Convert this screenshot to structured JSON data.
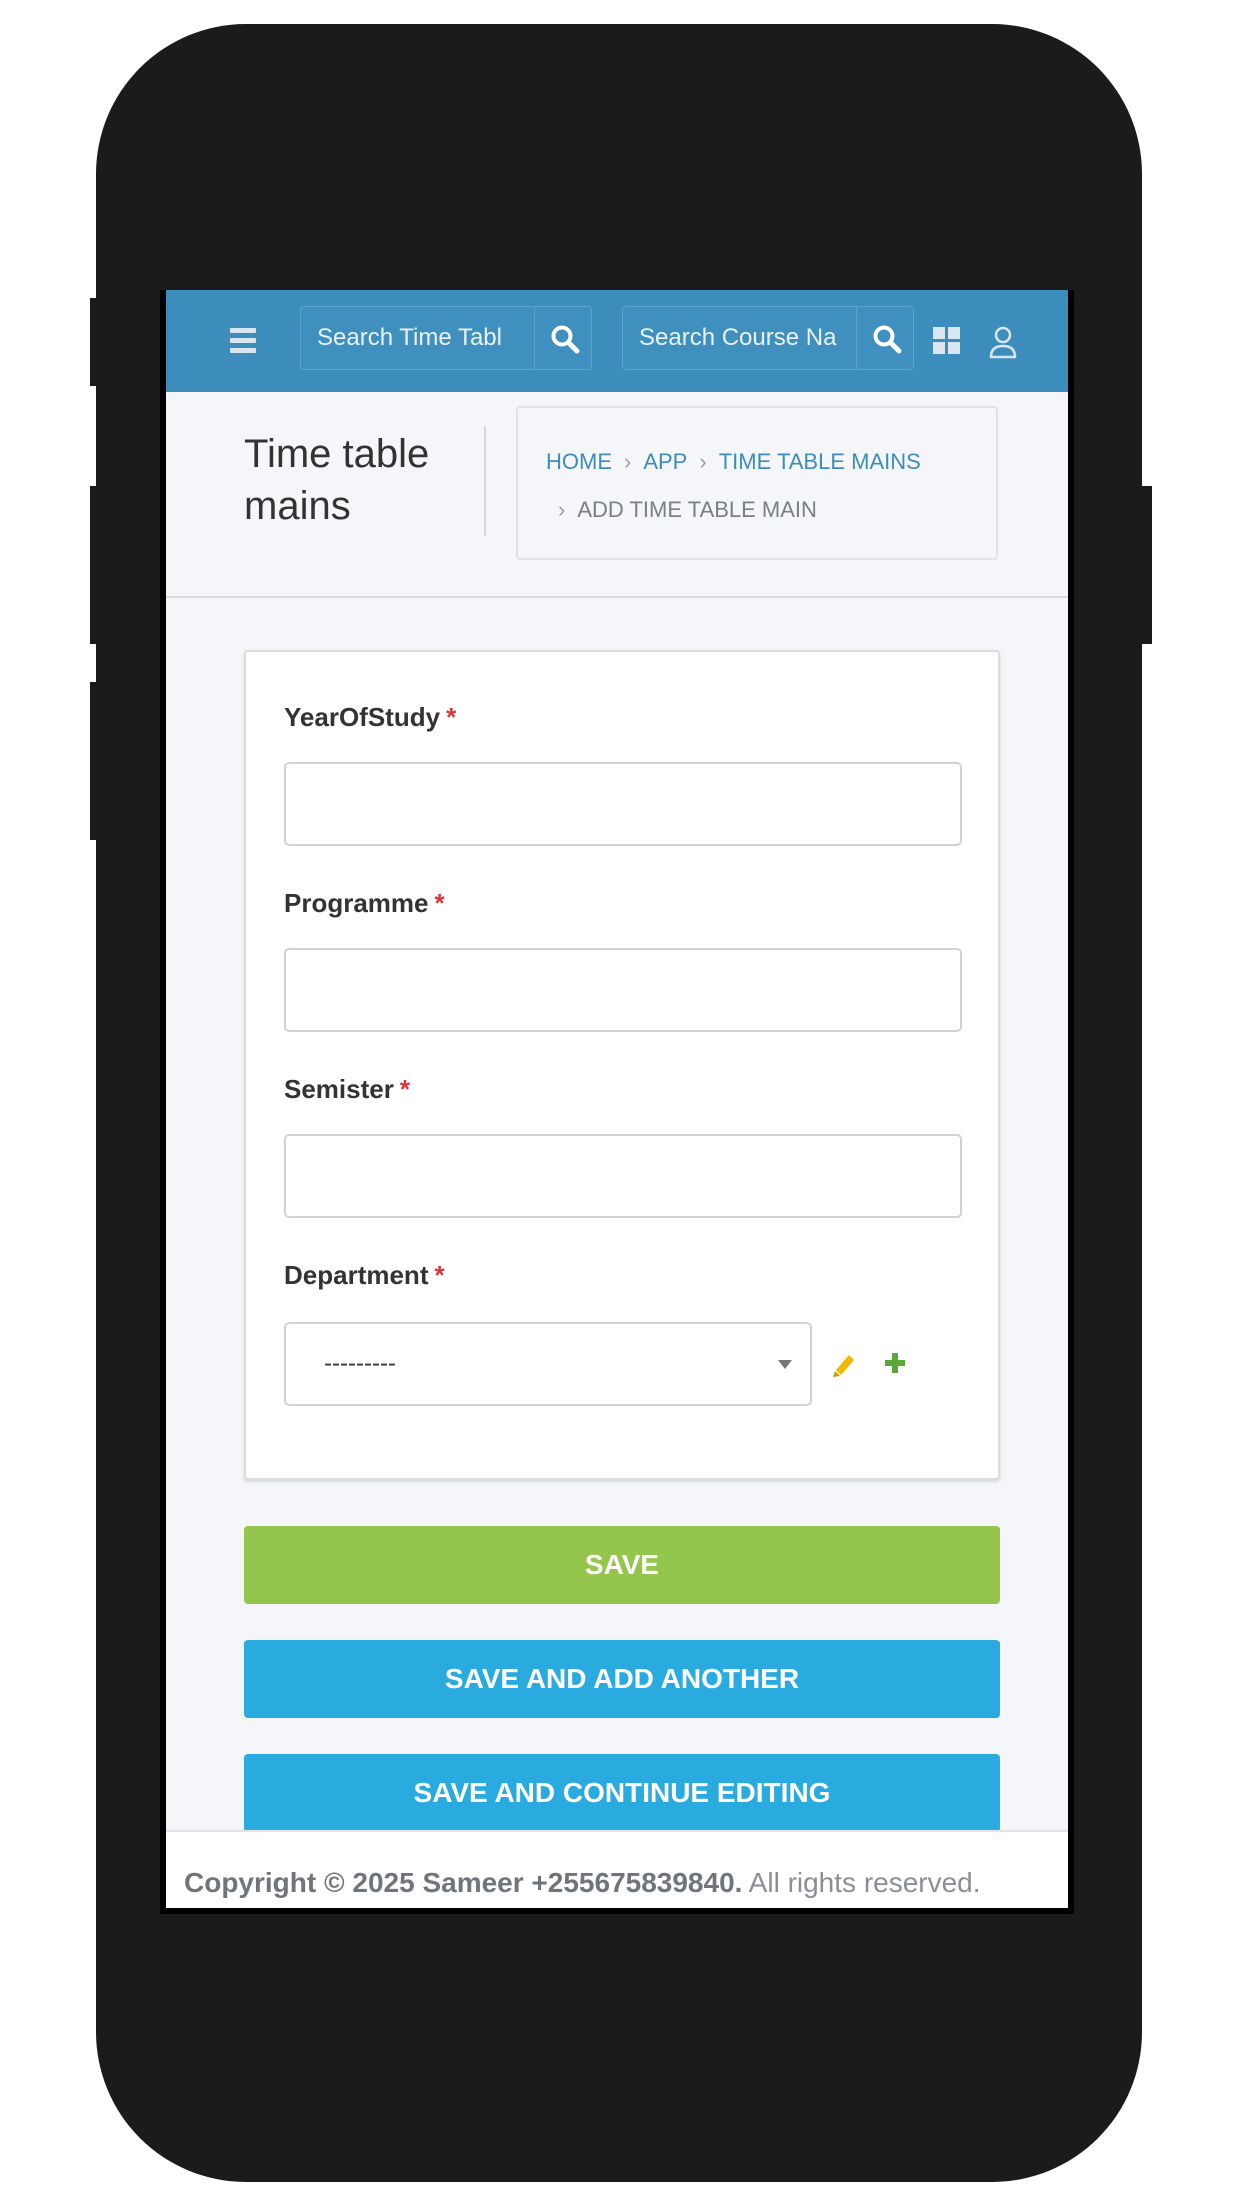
{
  "navbar": {
    "search_time_table_placeholder": "Search Time Tabl",
    "search_course_placeholder": "Search Course Na"
  },
  "header": {
    "title": "Time table mains",
    "breadcrumb": {
      "home": "HOME",
      "app": "APP",
      "section": "TIME TABLE MAINS",
      "current": "ADD TIME TABLE MAIN",
      "separator": "›"
    }
  },
  "form": {
    "required_marker": "*",
    "year_of_study_label": "YearOfStudy",
    "programme_label": "Programme",
    "semister_label": "Semister",
    "department_label": "Department",
    "department_selected": "---------"
  },
  "buttons": {
    "save": "SAVE",
    "save_add_another": "SAVE AND ADD ANOTHER",
    "save_continue": "SAVE AND CONTINUE EDITING"
  },
  "footer": {
    "copyright": "Copyright © 2025 Sameer +255675839840.",
    "rights": "All rights reserved."
  },
  "colors": {
    "navbar": "#3c8dbc",
    "save_button": "#94c54c",
    "secondary_button": "#2aabe0",
    "required": "#d9343a",
    "edit_icon": "#f0b800",
    "add_icon": "#5aa838"
  }
}
